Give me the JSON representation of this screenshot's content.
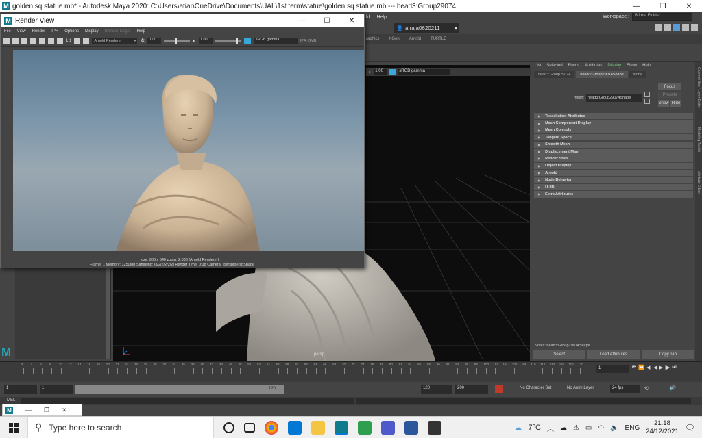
{
  "window": {
    "title": "golden sq statue.mb* - Autodesk Maya 2020: C:\\Users\\atiar\\OneDrive\\Documents\\UAL\\1st term\\statue\\golden sq statue.mb   ---   head3:Group29074"
  },
  "maya_menubar": {
    "items": [
      "ld",
      "Help"
    ],
    "workspace_label": "Workspace :",
    "workspace_value": "Bifrost Fluids*"
  },
  "status_line": {
    "user": "a.raja0620211"
  },
  "shelf_tabs": [
    "raphics",
    "XGen",
    "Arnold",
    "TURTLE"
  ],
  "viewport": {
    "exposure": "1.00",
    "color_space": "sRGB gamma",
    "camera_label": "persp"
  },
  "render_view": {
    "title": "Render View",
    "menu": [
      "File",
      "View",
      "Render",
      "IPR",
      "Options",
      "Display",
      "Render Target",
      "Help"
    ],
    "toolbar": {
      "ratio": "1:1",
      "renderer": "Arnold Renderer",
      "exposure": "0.00",
      "gamma": "1.00",
      "color_space": "sRGB gamma",
      "ipr_mem": "IPR: 0MB"
    },
    "status_line1": "size: 960 x 540 zoom: 2.038     (Arnold Renderer)",
    "status_line2": "Frame: 1    Memory: 1250Mb    Sampling: [3/2/2/2/2/2]    Render Time: 0:18    Camera: |persp|perspShape"
  },
  "attribute_editor": {
    "menu": [
      "List",
      "Selected",
      "Focus",
      "Attributes",
      "Display",
      "Show",
      "Help"
    ],
    "active_menu": "Display",
    "tabs": [
      "head3:Group29074",
      "head3:Group29074Shape",
      "stone"
    ],
    "selected_tab": "head3:Group29074Shape",
    "mesh_label": "mesh:",
    "mesh_value": "head3:Group29074Shape",
    "focus_button": "Focus",
    "presets_button": "Presets",
    "show_button": "Show",
    "hide_button": "Hide",
    "sections": [
      "Tessellation Attributes",
      "Mesh Component Display",
      "Mesh Controls",
      "Tangent Space",
      "Smooth Mesh",
      "Displacement Map",
      "Render Stats",
      "Object Display",
      "Arnold",
      "Node Behavior",
      "UUID",
      "Extra Attributes"
    ],
    "notes": "Notes:  head3:Group29074Shape",
    "bottom_buttons": [
      "Select",
      "Load Attributes",
      "Copy Tab"
    ]
  },
  "side_tabs": [
    "Channel Box / Layer Editor",
    "Modeling Toolkit",
    "Attribute Editor"
  ],
  "timeline": {
    "ticks": [
      "2",
      "4",
      "6",
      "8",
      "10",
      "12",
      "14",
      "16",
      "18",
      "20",
      "22",
      "24",
      "26",
      "28",
      "30",
      "32",
      "34",
      "36",
      "38",
      "40",
      "42",
      "44",
      "46",
      "48",
      "50",
      "52",
      "54",
      "56",
      "58",
      "60",
      "62",
      "64",
      "66",
      "68",
      "70",
      "72",
      "74",
      "76",
      "78",
      "80",
      "82",
      "84",
      "86",
      "88",
      "90",
      "92",
      "94",
      "96",
      "98",
      "100",
      "102",
      "104",
      "106",
      "108",
      "110",
      "112",
      "114",
      "116",
      "118",
      "120"
    ],
    "current_frame": "1"
  },
  "range": {
    "start": "1",
    "playback_start": "1",
    "bar_start": "1",
    "bar_end": "120",
    "playback_end": "120",
    "end": "200",
    "character_set": "No Character Set",
    "anim_layer": "No Anim Layer",
    "fps": "24 fps"
  },
  "cmdline": {
    "label": "MEL"
  },
  "taskbar": {
    "search_placeholder": "Type here to search",
    "temperature": "7°C",
    "language": "ENG",
    "time": "21:18",
    "date": "24/12/2021"
  },
  "colors": {
    "maya_teal": "#0f7b8c",
    "active_green": "#7fd37f",
    "gamma_blue": "#38a8d8"
  }
}
